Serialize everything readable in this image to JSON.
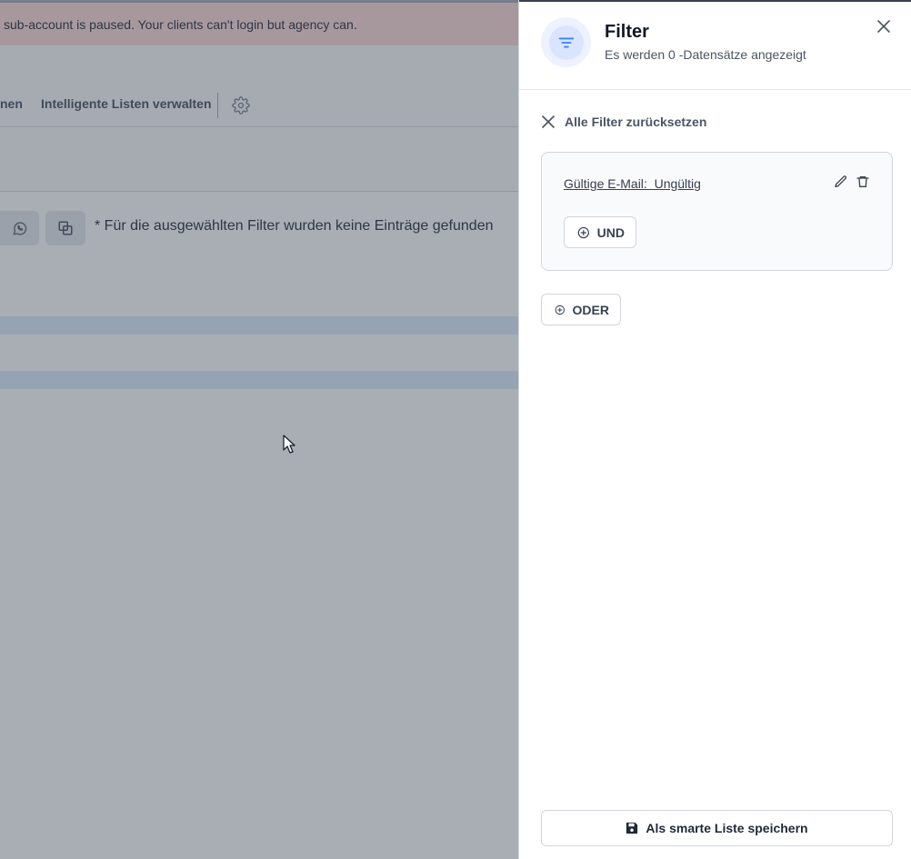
{
  "banner": {
    "text": "sub-account is paused. Your clients can't login but agency can."
  },
  "toolbar": {
    "partial_item": "nen",
    "smart_lists": "Intelligente Listen verwalten",
    "settings_icon": "gear-icon"
  },
  "content": {
    "empty_message": "* Für die ausgewählten Filter wurden keine Einträge gefunden",
    "whatsapp_icon": "whatsapp-icon",
    "copy_icon": "copy-icon"
  },
  "drawer": {
    "title": "Filter",
    "subtitle": "Es werden 0 -Datensätze angezeigt",
    "filter_icon": "filter-icon",
    "close_icon": "close-icon",
    "reset_label": "Alle Filter zurücksetzen",
    "group": {
      "condition": "Gültige E-Mail:  Ungültig",
      "and_label": "UND"
    },
    "or_label": "ODER",
    "save_label": "Als smarte Liste speichern"
  },
  "colors": {
    "banner_bg": "#fbd5d5",
    "accent": "#3b82f6",
    "overlay": "#4b5563"
  }
}
